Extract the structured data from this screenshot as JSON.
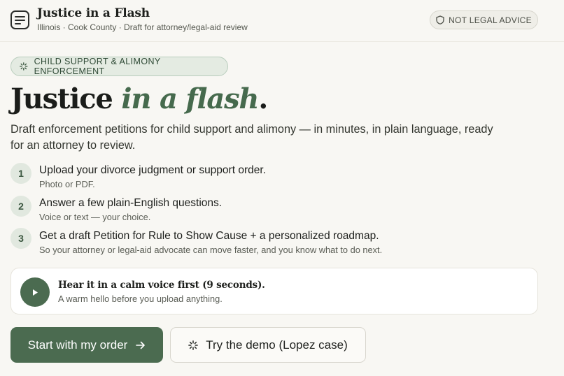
{
  "header": {
    "title": "Justice in a Flash",
    "subtitle": "Illinois · Cook County · Draft for attorney/legal-aid review",
    "app_icon": "document-lines-icon",
    "badge": {
      "label": "NOT LEGAL ADVICE",
      "icon": "shield-icon"
    }
  },
  "hero": {
    "category": {
      "label": "CHILD SUPPORT & ALIMONY ENFORCEMENT",
      "icon": "spark-icon"
    },
    "title_main": "Justice ",
    "title_accent": "in a flash",
    "title_end": ".",
    "description": "Draft enforcement petitions for child support and alimony — in minutes, in plain language, ready for an attorney to review."
  },
  "steps": [
    {
      "number": "1",
      "title": "Upload your divorce judgment or support order.",
      "subtitle": "Photo or PDF."
    },
    {
      "number": "2",
      "title": "Answer a few plain-English questions.",
      "subtitle": "Voice or text — your choice."
    },
    {
      "number": "3",
      "title": "Get a draft Petition for Rule to Show Cause + a personalized roadmap.",
      "subtitle": "So your attorney or legal-aid advocate can move faster, and you know what to do next."
    }
  ],
  "voice": {
    "title": "Hear it in a calm voice first (9 seconds).",
    "subtitle": "A warm hello before you upload anything.",
    "icon": "play-icon"
  },
  "actions": {
    "primary": {
      "label": "Start with my order",
      "icon": "arrow-right-icon"
    },
    "secondary": {
      "label": "Try the demo (Lopez case)",
      "icon": "spark-icon"
    }
  },
  "colors": {
    "accent": "#4b6b50",
    "accent_text": "#466a4d",
    "background": "#f8f7f3",
    "pill_background": "#e4ebe2"
  }
}
